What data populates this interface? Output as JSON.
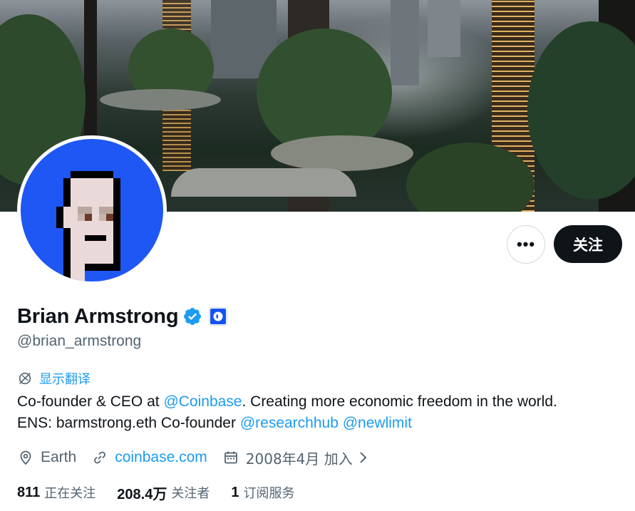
{
  "profile": {
    "display_name": "Brian Armstrong",
    "handle": "@brian_armstrong",
    "verified_icon": "verified-badge-icon",
    "affiliation_icon": "coinbase-logo-icon"
  },
  "actions": {
    "more_label": "•••",
    "follow_label": "关注"
  },
  "translate_label": "显示翻译",
  "bio": {
    "line1_prefix": "Co-founder & CEO at ",
    "line1_mention": "@Coinbase",
    "line1_suffix": ". Creating more economic freedom in the world.",
    "line2_prefix": "ENS: barmstrong.eth Co-founder ",
    "line2_mention1": "@researchhub",
    "line2_space": " ",
    "line2_mention2": "@newlimit"
  },
  "meta": {
    "location": "Earth",
    "website": "coinbase.com",
    "joined": "2008年4月 加入"
  },
  "stats": {
    "following_count": "811",
    "following_label": "正在关注",
    "followers_count": "208.4万",
    "followers_label": "关注者",
    "subscriptions_count": "1",
    "subscriptions_label": "订阅服务"
  },
  "colors": {
    "accent": "#1d9bf0",
    "text_primary": "#0f1419",
    "text_secondary": "#536471",
    "avatar_bg": "#1e57f3"
  }
}
